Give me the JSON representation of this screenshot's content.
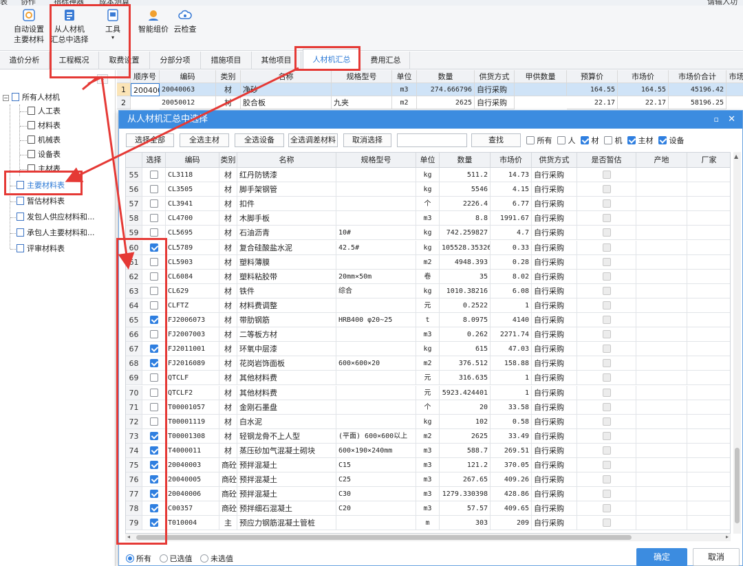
{
  "menubar": {
    "items": [
      "表",
      "协作",
      "指标神器",
      "成本测算"
    ],
    "search": "请输入功"
  },
  "ribbon": {
    "buttons": [
      {
        "label1": "自动设置",
        "label2": "主要材料",
        "icon": "auto-set-icon"
      },
      {
        "label1": "从人材机",
        "label2": "汇总中选择",
        "icon": "select-from-summary-icon"
      },
      {
        "label1": "工具",
        "label2": "▾",
        "icon": "tools-icon"
      },
      {
        "label1": "智能组价",
        "label2": "",
        "icon": "smart-pricing-icon"
      },
      {
        "label1": "云检查",
        "label2": "",
        "icon": "cloud-check-icon"
      }
    ]
  },
  "tabs": [
    "造价分析",
    "工程概况",
    "取费设置",
    "分部分项",
    "措施项目",
    "其他项目",
    "人材机汇总",
    "费用汇总"
  ],
  "active_tab": "人材机汇总",
  "tree": {
    "root": "所有人材机",
    "children": [
      "人工表",
      "材料表",
      "机械表",
      "设备表",
      "主材表"
    ],
    "others": [
      "主要材料表",
      "暂估材料表",
      "发包人供应材料和...",
      "承包人主要材料和...",
      "评审材料表"
    ],
    "selected": "主要材料表"
  },
  "bg_table": {
    "headers": [
      "顺序号",
      "编码",
      "类别",
      "名称",
      "规格型号",
      "单位",
      "数量",
      "供货方式",
      "甲供数量",
      "预算价",
      "市场价",
      "市场价合计",
      "市场"
    ],
    "rows": [
      [
        "1",
        "20040063",
        "材",
        "净砂",
        "",
        "m3",
        "274.666796",
        "自行采购",
        "",
        "164.55",
        "164.55",
        "45196.42",
        ""
      ],
      [
        "2",
        "20050012",
        "材",
        "胶合板",
        "九夹",
        "m2",
        "2625",
        "自行采购",
        "",
        "22.17",
        "22.17",
        "58196.25",
        ""
      ]
    ]
  },
  "dialog": {
    "title": "从人材机汇总中选择",
    "toolbar": {
      "select_all": "选择全部",
      "select_main": "全选主材",
      "select_equip": "全选设备",
      "select_adjust": "全选调差材料",
      "cancel_select": "取消选择",
      "search_placeholder": "",
      "find": "查找"
    },
    "filters": [
      {
        "label": "所有",
        "checked": false
      },
      {
        "label": "人",
        "checked": false
      },
      {
        "label": "材",
        "checked": true
      },
      {
        "label": "机",
        "checked": false
      },
      {
        "label": "主材",
        "checked": true
      },
      {
        "label": "设备",
        "checked": true
      }
    ],
    "headers": [
      "",
      "选择",
      "编码",
      "类别",
      "名称",
      "规格型号",
      "单位",
      "数量",
      "市场价",
      "供货方式",
      "是否暂估",
      "产地",
      "厂家"
    ],
    "rows": [
      {
        "n": "55",
        "sel": false,
        "code": "CL3118",
        "type": "材",
        "name": "红丹防锈漆",
        "spec": "",
        "unit": "kg",
        "qty": "511.2",
        "price": "14.73",
        "supply": "自行采购"
      },
      {
        "n": "56",
        "sel": false,
        "code": "CL3505",
        "type": "材",
        "name": "脚手架钢管",
        "spec": "",
        "unit": "kg",
        "qty": "5546",
        "price": "4.15",
        "supply": "自行采购"
      },
      {
        "n": "57",
        "sel": false,
        "code": "CL3941",
        "type": "材",
        "name": "扣件",
        "spec": "",
        "unit": "个",
        "qty": "2226.4",
        "price": "6.77",
        "supply": "自行采购"
      },
      {
        "n": "58",
        "sel": false,
        "code": "CL4700",
        "type": "材",
        "name": "木脚手板",
        "spec": "",
        "unit": "m3",
        "qty": "8.8",
        "price": "1991.67",
        "supply": "自行采购"
      },
      {
        "n": "59",
        "sel": false,
        "code": "CL5695",
        "type": "材",
        "name": "石油沥青",
        "spec": "10#",
        "unit": "kg",
        "qty": "742.259827",
        "price": "4.7",
        "supply": "自行采购"
      },
      {
        "n": "60",
        "sel": true,
        "code": "CL5789",
        "type": "材",
        "name": "复合硅酸盐水泥",
        "spec": "42.5#",
        "unit": "kg",
        "qty": "105528.35326",
        "price": "0.33",
        "supply": "自行采购"
      },
      {
        "n": "61",
        "sel": false,
        "code": "CL5903",
        "type": "材",
        "name": "塑料薄膜",
        "spec": "",
        "unit": "m2",
        "qty": "4948.393",
        "price": "0.28",
        "supply": "自行采购"
      },
      {
        "n": "62",
        "sel": false,
        "code": "CL6084",
        "type": "材",
        "name": "塑料粘胶带",
        "spec": "20mm×50m",
        "unit": "卷",
        "qty": "35",
        "price": "8.02",
        "supply": "自行采购"
      },
      {
        "n": "63",
        "sel": false,
        "code": "CL629",
        "type": "材",
        "name": "铁件",
        "spec": "综合",
        "unit": "kg",
        "qty": "1010.38216",
        "price": "6.08",
        "supply": "自行采购"
      },
      {
        "n": "64",
        "sel": false,
        "code": "CLFTZ",
        "type": "材",
        "name": "材料费调整",
        "spec": "",
        "unit": "元",
        "qty": "0.2522",
        "price": "1",
        "supply": "自行采购"
      },
      {
        "n": "65",
        "sel": true,
        "code": "FJ2006073",
        "type": "材",
        "name": "带肋钢筋",
        "spec": "HRB400 φ20~25",
        "unit": "t",
        "qty": "8.0975",
        "price": "4140",
        "supply": "自行采购"
      },
      {
        "n": "66",
        "sel": false,
        "code": "FJ2007003",
        "type": "材",
        "name": "二等板方材",
        "spec": "",
        "unit": "m3",
        "qty": "0.262",
        "price": "2271.74",
        "supply": "自行采购"
      },
      {
        "n": "67",
        "sel": true,
        "code": "FJ2011001",
        "type": "材",
        "name": "环氧中层漆",
        "spec": "",
        "unit": "kg",
        "qty": "615",
        "price": "47.03",
        "supply": "自行采购"
      },
      {
        "n": "68",
        "sel": true,
        "code": "FJ2016089",
        "type": "材",
        "name": "花岗岩饰面板",
        "spec": "600×600×20",
        "unit": "m2",
        "qty": "376.512",
        "price": "158.88",
        "supply": "自行采购"
      },
      {
        "n": "69",
        "sel": false,
        "code": "QTCLF",
        "type": "材",
        "name": "其他材料费",
        "spec": "",
        "unit": "元",
        "qty": "316.635",
        "price": "1",
        "supply": "自行采购"
      },
      {
        "n": "70",
        "sel": false,
        "code": "QTCLF2",
        "type": "材",
        "name": "其他材料费",
        "spec": "",
        "unit": "元",
        "qty": "5923.424401",
        "price": "1",
        "supply": "自行采购"
      },
      {
        "n": "71",
        "sel": false,
        "code": "T00001057",
        "type": "材",
        "name": "金刚石墨盘",
        "spec": "",
        "unit": "个",
        "qty": "20",
        "price": "33.58",
        "supply": "自行采购"
      },
      {
        "n": "72",
        "sel": false,
        "code": "T00001119",
        "type": "材",
        "name": "白水泥",
        "spec": "",
        "unit": "kg",
        "qty": "102",
        "price": "0.58",
        "supply": "自行采购"
      },
      {
        "n": "73",
        "sel": true,
        "code": "T00001308",
        "type": "材",
        "name": "轻钢龙骨不上人型",
        "spec": "(平面) 600×600以上",
        "unit": "m2",
        "qty": "2625",
        "price": "33.49",
        "supply": "自行采购"
      },
      {
        "n": "74",
        "sel": true,
        "code": "T4000011",
        "type": "材",
        "name": "蒸压砂加气混凝土砌块",
        "spec": "600×190×240mm",
        "unit": "m3",
        "qty": "588.7",
        "price": "269.51",
        "supply": "自行采购"
      },
      {
        "n": "75",
        "sel": true,
        "code": "20040003",
        "type": "商砼",
        "name": "预拌混凝土",
        "spec": "C15",
        "unit": "m3",
        "qty": "121.2",
        "price": "370.05",
        "supply": "自行采购"
      },
      {
        "n": "76",
        "sel": true,
        "code": "20040005",
        "type": "商砼",
        "name": "预拌混凝土",
        "spec": "C25",
        "unit": "m3",
        "qty": "267.65",
        "price": "409.26",
        "supply": "自行采购"
      },
      {
        "n": "77",
        "sel": true,
        "code": "20040006",
        "type": "商砼",
        "name": "预拌混凝土",
        "spec": "C30",
        "unit": "m3",
        "qty": "1279.330398",
        "price": "428.86",
        "supply": "自行采购"
      },
      {
        "n": "78",
        "sel": true,
        "code": "C00357",
        "type": "商砼",
        "name": "预拌细石混凝土",
        "spec": "C20",
        "unit": "m3",
        "qty": "57.57",
        "price": "409.65",
        "supply": "自行采购"
      },
      {
        "n": "79",
        "sel": true,
        "code": "T010004",
        "type": "主",
        "name": "预应力钢筋混凝土管桩",
        "spec": "",
        "unit": "m",
        "qty": "303",
        "price": "209",
        "supply": "自行采购"
      }
    ],
    "radios": [
      {
        "label": "所有",
        "on": true
      },
      {
        "label": "已选值",
        "on": false
      },
      {
        "label": "未选值",
        "on": false
      }
    ],
    "ok": "确定",
    "cancel": "取消"
  },
  "colors": {
    "accent": "#3c8ce0",
    "annotation": "#e53935"
  }
}
